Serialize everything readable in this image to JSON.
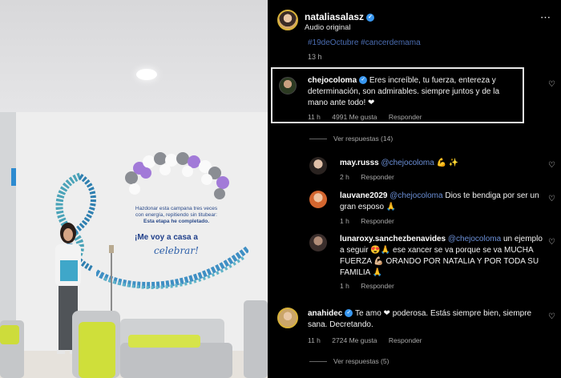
{
  "header": {
    "username": "nataliasalasz",
    "subtitle": "Audio original",
    "more": "⋯"
  },
  "caption": {
    "hashtags": "#19deOctubre #cancerdemama",
    "time": "13 h"
  },
  "wall": {
    "line1": "Hazdonar esta campana tres veces",
    "line2": "con energía, repitiendo sin titubear:",
    "line3": "Esta etapa he completado.",
    "big": "¡Me voy a casa a",
    "script": "celebrar!"
  },
  "comments": [
    {
      "user": "chejocoloma",
      "verified": true,
      "text": "Eres increíble, tu fuerza, entereza y determinación, son admirables. siempre juntos y de la mano ante todo! ❤",
      "time": "11 h",
      "likes": "4991 Me gusta",
      "reply": "Responder",
      "replies": "Ver respuestas (14)"
    },
    {
      "user": "may.russs",
      "mention": "@chejocoloma",
      "text": "💪 ✨",
      "time": "2 h",
      "reply": "Responder"
    },
    {
      "user": "lauvane2029",
      "mention": "@chejocoloma",
      "text": "Dios te bendiga por ser un gran esposo 🙏",
      "time": "1 h",
      "reply": "Responder"
    },
    {
      "user": "lunaroxy.sanchezbenavides",
      "mention": "@chejocoloma",
      "text": "un ejemplo a seguir 😍🙏 ese xancer se va porque se va MUCHA FUERZA 💪🏼 ORANDO POR NATALIA Y POR TODA SU FAMILIA 🙏",
      "time": "1 h",
      "reply": "Responder"
    },
    {
      "user": "anahidec",
      "verified": true,
      "text": "Te amo ❤ poderosa. Estás siempre bien, siempre sana. Decretando.",
      "time": "11 h",
      "likes": "2724 Me gusta",
      "reply": "Responder",
      "replies": "Ver respuestas (5)"
    }
  ],
  "icons": {
    "heart": "♡",
    "verified": "✓"
  },
  "colors": {
    "mention": "#6b8fd6",
    "verified": "#3897f0",
    "like_heart": "#ff3b5c"
  }
}
